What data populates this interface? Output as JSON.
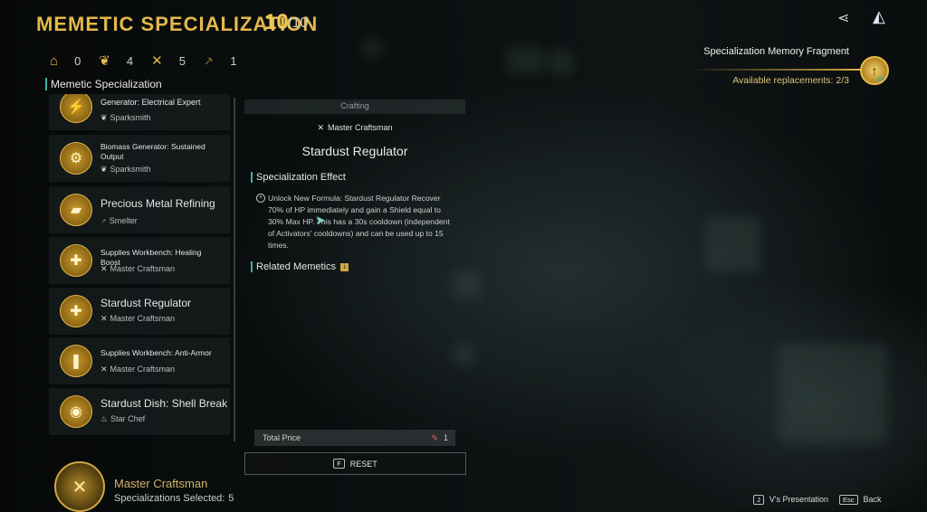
{
  "header": {
    "title": "MEMETIC SPECIALIZATION",
    "count": "10",
    "count_max": "/10"
  },
  "stats": [
    {
      "icon": "house-icon",
      "glyph": "⌂",
      "value": "0"
    },
    {
      "icon": "leaf-icon",
      "glyph": "❦",
      "value": "4"
    },
    {
      "icon": "crossed-tools-icon",
      "glyph": "✕",
      "value": "5"
    },
    {
      "icon": "hammer-icon",
      "glyph": "⸕",
      "value": "1"
    }
  ],
  "section_label": "Memetic Specialization",
  "list": [
    {
      "title": "Generator: Electrical Expert",
      "sub": "Sparksmith",
      "sub_icon": "leaf-icon",
      "size": "small"
    },
    {
      "title": "Biomass Generator: Sustained Output",
      "sub": "Sparksmith",
      "sub_icon": "leaf-icon",
      "size": "small"
    },
    {
      "title": "Precious Metal Refining",
      "sub": "Smelter",
      "sub_icon": "hammer-icon",
      "size": "big"
    },
    {
      "title": "Supplies Workbench: Healing Boost",
      "sub": "Master Craftsman",
      "sub_icon": "crossed-tools-icon",
      "size": "small"
    },
    {
      "title": "Stardust Regulator",
      "sub": "Master Craftsman",
      "sub_icon": "crossed-tools-icon",
      "size": "big"
    },
    {
      "title": "Supplies Workbench: Anti-Armor",
      "sub": "Master Craftsman",
      "sub_icon": "crossed-tools-icon",
      "size": "small"
    },
    {
      "title": "Stardust Dish: Shell Break",
      "sub": "Star Chef",
      "sub_icon": "chef-icon",
      "size": "big"
    }
  ],
  "role": {
    "name": "Master Craftsman",
    "selected_label": "Specializations Selected:",
    "selected_value": "5"
  },
  "detail": {
    "category": "Crafting",
    "tag": "Master Craftsman",
    "title": "Stardust Regulator",
    "effect_heading": "Specialization Effect",
    "effect_text": "Unlock New Formula: Stardust Regulator Recover 70% of HP immediately and gain a Shield equal to 30% Max HP. This has a 30s cooldown (independent of Activators' cooldowns) and can be used up to 15 times.",
    "related_heading": "Related Memetics",
    "total_label": "Total Price",
    "total_value": "1",
    "reset_key": "F",
    "reset_label": "RESET"
  },
  "fragment": {
    "title": "Specialization Memory Fragment",
    "replacements": "Available replacements: 2/3"
  },
  "footer": {
    "presentation_key": "J",
    "presentation_label": "V's Presentation",
    "back_key": "Esc",
    "back_label": "Back"
  },
  "colors": {
    "accent_gold": "#e4b94a",
    "accent_teal": "#3bb3a3"
  }
}
